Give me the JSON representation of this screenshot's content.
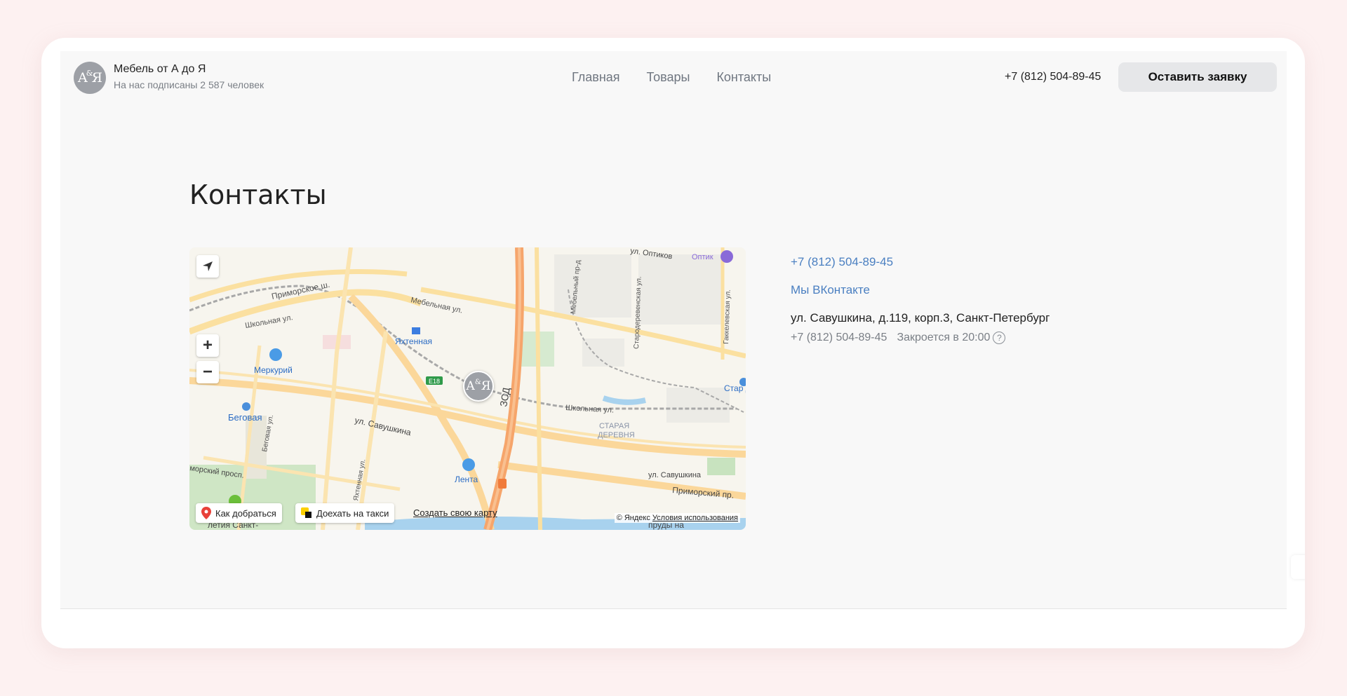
{
  "header": {
    "logo_text": "A&Я",
    "brand_name": "Мебель от А до Я",
    "subscribers": "На нас подписаны 2 587 человек",
    "nav": [
      {
        "label": "Главная"
      },
      {
        "label": "Товары"
      },
      {
        "label": "Контакты"
      }
    ],
    "phone": "+7 (812) 504-89-45",
    "cta_label": "Оставить заявку"
  },
  "page": {
    "title": "Контакты"
  },
  "map": {
    "zoom_in": "+",
    "zoom_out": "−",
    "route_label": "Как добраться",
    "taxi_label": "Доехать на такси",
    "create_map_label": "Создать свою карту",
    "copyright": "© Яндекс",
    "terms_label": "Условия использования",
    "labels": {
      "primorskoe": "Приморское ш.",
      "melnichnaya": "Мебельная ул.",
      "shkolnaya": "Школьная ул.",
      "shkolnaya2": "Школьная ул.",
      "yakhtennaya": "Яхтенная",
      "merkuriy": "Меркурий",
      "begovaya": "Беговая",
      "savushkina": "ул. Савушкина",
      "savushkina2": "ул. Савушкина",
      "lenta": "Лента",
      "zsd": "ЗСД",
      "e18": "E18",
      "staraya": "СТАРАЯ",
      "derevnya": "ДЕРЕВНЯ",
      "optik": "Оптик",
      "optikov": "ул. Оптиков",
      "primorsky_pr": "Приморский пр.",
      "primorsky_prosp": "морский просп.",
      "begovaya_ul": "Беговая ул.",
      "yakhtennaya_ul": "Яхтенная ул.",
      "staroderevenskaya": "Стародеревенская ул.",
      "gakkelevskaya": "Гаккелевская ул.",
      "mebelny_pr": "Мебельный пр-д",
      "star_dere": "Стар Дере",
      "letiya": "летия Санкт-",
      "prudy": "пруды на"
    }
  },
  "contacts": {
    "phone": "+7 (812) 504-89-45",
    "vk": "Мы ВКонтакте",
    "address": "ул. Савушкина, д.119, корп.3, Санкт-Петербург",
    "phone2": "+7 (812) 504-89-45",
    "hours": "Закроется в 20:00",
    "help_icon": "?"
  }
}
